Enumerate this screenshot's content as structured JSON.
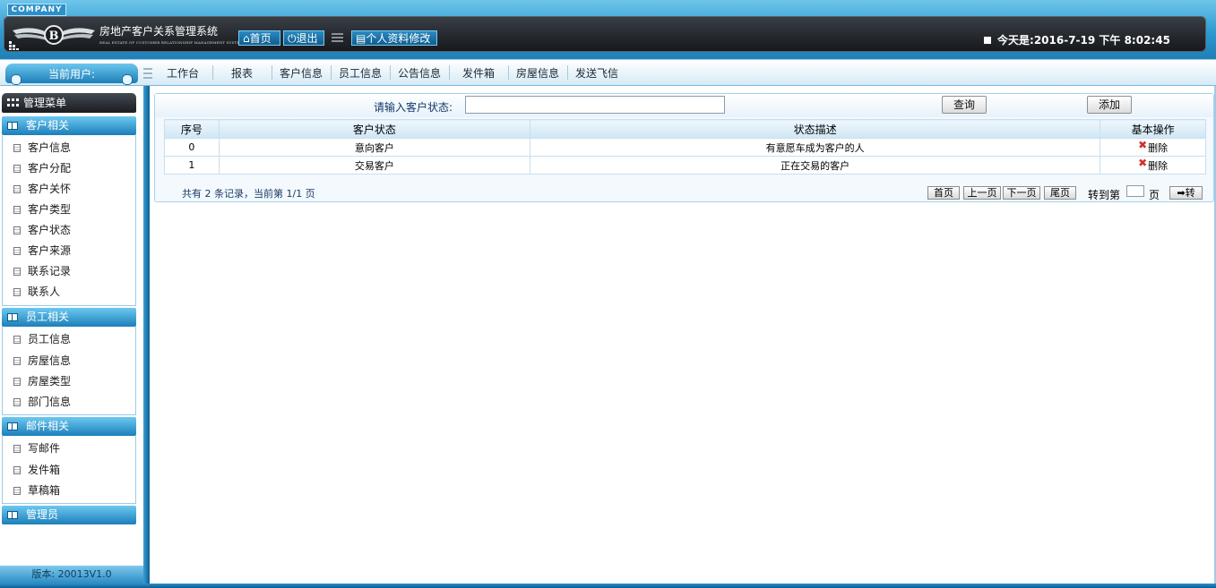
{
  "banner": {
    "company_tag": "COMPANY",
    "title": "房地产客户关系管理系统",
    "subtitle": "REAL ESTATE OF CUSTOMER RELATIONSHIP MANAGEMENT SYSTEM",
    "home_label": "首页",
    "exit_label": "退出",
    "profile_label": "个人资料修改",
    "date_label": "今天是:",
    "date_value": "2016-7-19 下午 8:02:45"
  },
  "navbar": {
    "current_user_label": "当前用户:",
    "items": [
      "工作台",
      "报表",
      "客户信息",
      "员工信息",
      "公告信息",
      "发件箱",
      "房屋信息",
      "发送飞信"
    ]
  },
  "sidebar": {
    "menu_title": "管理菜单",
    "groups": [
      {
        "title": "客户相关",
        "items": [
          "客户信息",
          "客户分配",
          "客户关怀",
          "客户类型",
          "客户状态",
          "客户来源",
          "联系记录",
          "联系人"
        ]
      },
      {
        "title": "员工相关",
        "items": [
          "员工信息",
          "房屋信息",
          "房屋类型",
          "部门信息"
        ]
      },
      {
        "title": "邮件相关",
        "items": [
          "写邮件",
          "发件箱",
          "草稿箱"
        ]
      },
      {
        "title": "管理员",
        "items": []
      }
    ],
    "version": "版本: 20013V1.0"
  },
  "main": {
    "search_label": "请输入客户状态:",
    "search_value": "",
    "query_label": "查询",
    "add_label": "添加",
    "columns": [
      "序号",
      "客户状态",
      "状态描述",
      "基本操作"
    ],
    "rows": [
      {
        "id": "0",
        "status": "意向客户",
        "desc": "有意愿车成为客户的人",
        "action": "删除"
      },
      {
        "id": "1",
        "status": "交易客户",
        "desc": "正在交易的客户",
        "action": "删除"
      }
    ],
    "pager": {
      "info": "共有 2 条记录，当前第 1/1 页",
      "first": "首页",
      "prev": "上一页",
      "next": "下一页",
      "last": "尾页",
      "goto_label": "转到第",
      "goto_value": "",
      "page_unit": "页",
      "goto_btn": "➡转"
    }
  },
  "colors": {
    "accent_blue": "#2d9ad0",
    "dark_bar": "#1a1d21",
    "delete_red": "#d0302a"
  }
}
